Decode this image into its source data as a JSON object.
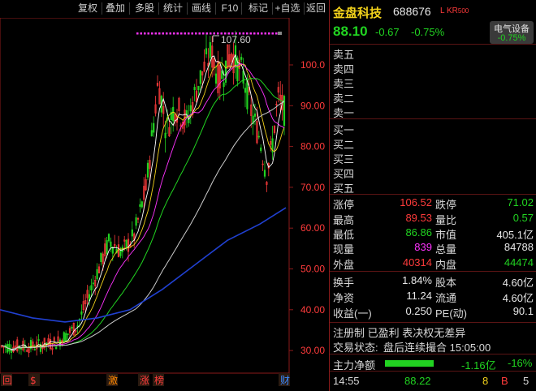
{
  "toolbar": {
    "items": [
      "复权",
      "叠加",
      "多股",
      "统计",
      "画线",
      "F10",
      "标记",
      "+自选",
      "返回"
    ]
  },
  "chart": {
    "y_ticks": [
      "100.0",
      "90.00",
      "80.00",
      "70.00",
      "60.00",
      "50.00",
      "40.00",
      "30.00"
    ],
    "max_label": "107.60",
    "markers": [
      {
        "text": "回",
        "color": "#ff3b3b"
      },
      {
        "text": "$",
        "color": "#ff3b3b"
      },
      {
        "text": "激",
        "color": "#ff8800"
      },
      {
        "text": "涨",
        "color": "#ff3b3b"
      },
      {
        "text": "榜",
        "color": "#ff3b3b"
      },
      {
        "text": "财",
        "color": "#3b8bff"
      }
    ],
    "colors": {
      "up": "#ff3b3b",
      "down": "#21d321",
      "ma5": "#ffffff",
      "ma10": "#f2d21b",
      "ma20": "#ff33ff",
      "ma30": "#21d321",
      "ma60": "#cccccc",
      "ma120": "#2040d0"
    }
  },
  "stock": {
    "name": "金盘科技",
    "code": "688676",
    "tags": "L KR",
    "tag_sub": "500",
    "price": "88.10",
    "change": "-0.67",
    "change_pct": "-0.75%",
    "sector_name": "电气设备",
    "sector_change": "-0.75%"
  },
  "order_book": {
    "sell": [
      "卖五",
      "卖四",
      "卖三",
      "卖二",
      "卖一"
    ],
    "buy": [
      "买一",
      "买二",
      "买三",
      "买四",
      "买五"
    ]
  },
  "stats": [
    {
      "l1": "涨停",
      "v1": "106.52",
      "c1": "red",
      "l2": "跌停",
      "v2": "71.02",
      "c2": "green"
    },
    {
      "l1": "最高",
      "v1": "89.53",
      "c1": "red",
      "l2": "量比",
      "v2": "0.57",
      "c2": "green"
    },
    {
      "l1": "最低",
      "v1": "86.86",
      "c1": "green",
      "l2": "市值",
      "v2": "405.1亿",
      "c2": "white"
    },
    {
      "l1": "现量",
      "v1": "839",
      "c1": "magenta",
      "l2": "总量",
      "v2": "84788",
      "c2": "white"
    },
    {
      "l1": "外盘",
      "v1": "40314",
      "c1": "red",
      "l2": "内盘",
      "v2": "44474",
      "c2": "green"
    }
  ],
  "fundamentals": [
    {
      "l1": "换手",
      "v1": "1.84%",
      "l2": "股本",
      "v2": "4.60亿"
    },
    {
      "l1": "净资",
      "v1": "11.24",
      "l2": "流通",
      "v2": "4.60亿"
    },
    {
      "l1": "收益(一)",
      "v1": "0.250",
      "l2": "PE(动)",
      "v2": "90.1"
    }
  ],
  "status": {
    "registration": "注册制 已盈利 表决权无差异",
    "trade_state_label": "交易状态:",
    "trade_state": "盘后连续撮合 15:05:00",
    "net_flow_label": "主力净额",
    "net_flow_value": "-1.16亿",
    "net_flow_pct": "-16%",
    "tick_time": "14:55",
    "tick_price": "88.22",
    "tick_vol": "8",
    "tick_side": "B",
    "tick_count": "5"
  }
}
